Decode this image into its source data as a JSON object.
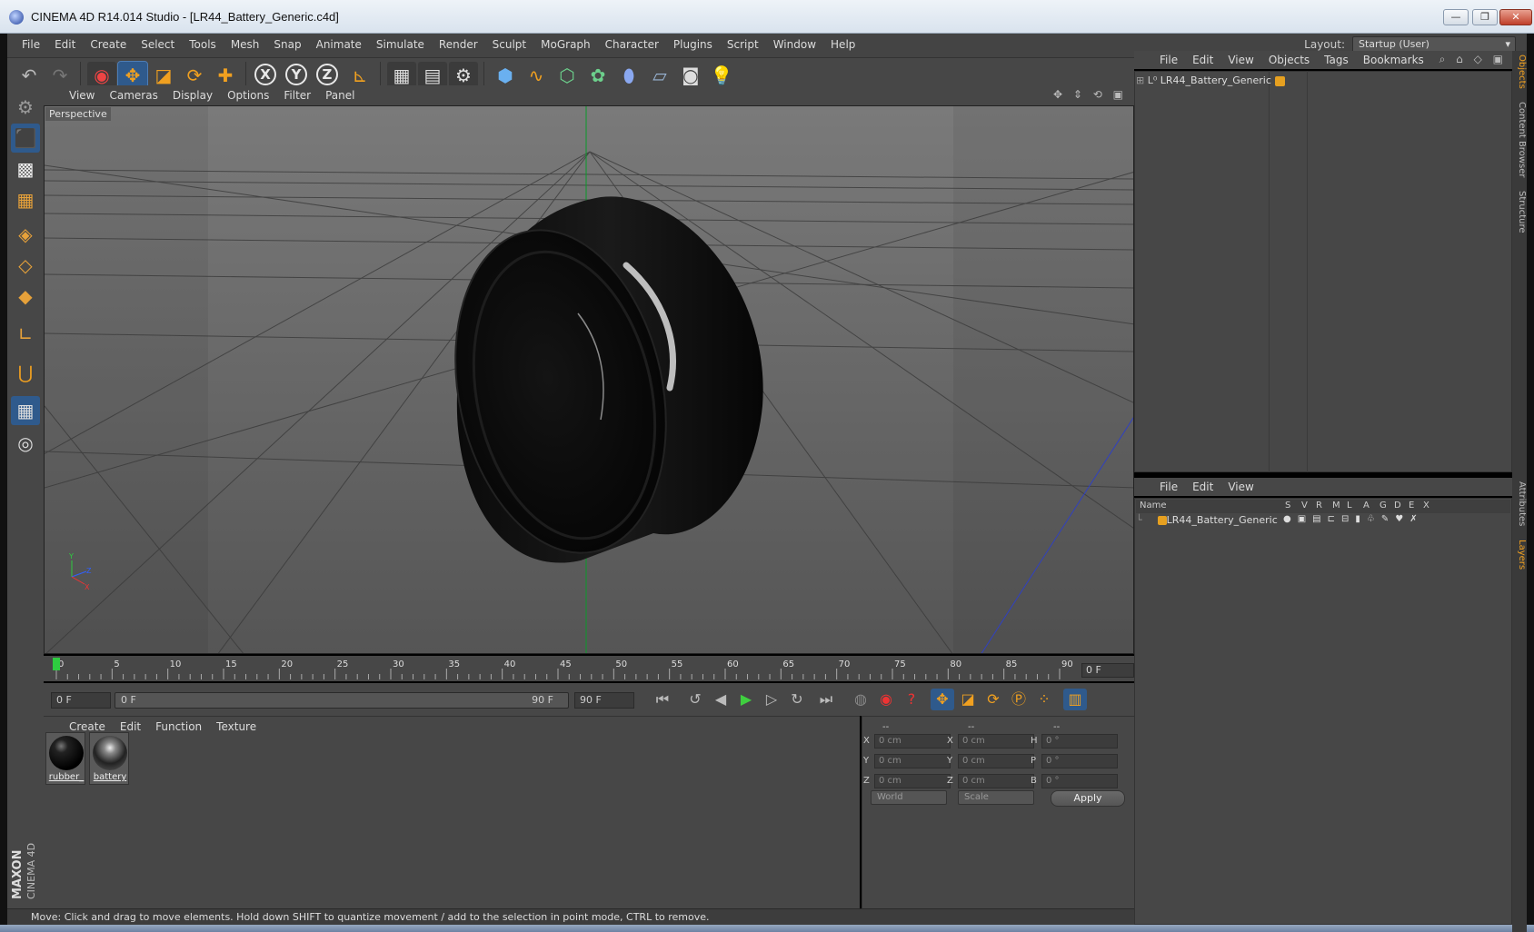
{
  "window": {
    "title": "CINEMA 4D R14.014 Studio - [LR44_Battery_Generic.c4d]",
    "minimize": "—",
    "restore": "❐",
    "close": "✕"
  },
  "menubar": {
    "items": [
      "File",
      "Edit",
      "Create",
      "Select",
      "Tools",
      "Mesh",
      "Snap",
      "Animate",
      "Simulate",
      "Render",
      "Sculpt",
      "MoGraph",
      "Character",
      "Plugins",
      "Script",
      "Window",
      "Help"
    ],
    "layout_label": "Layout:",
    "layout_value": "Startup (User)"
  },
  "viewport": {
    "menu": [
      "View",
      "Cameras",
      "Display",
      "Options",
      "Filter",
      "Panel"
    ],
    "label": "Perspective"
  },
  "timeline": {
    "ticks": [
      "0",
      "5",
      "10",
      "15",
      "20",
      "25",
      "30",
      "35",
      "40",
      "45",
      "50",
      "55",
      "60",
      "65",
      "70",
      "75",
      "80",
      "85",
      "90"
    ],
    "current_frame_box": "0 F",
    "start_field": "0 F",
    "range_start": "0 F",
    "range_end": "90 F",
    "end_field": "90 F"
  },
  "materials": {
    "menu": [
      "Create",
      "Edit",
      "Function",
      "Texture"
    ],
    "items": [
      {
        "name": "rubber_"
      },
      {
        "name": "battery"
      }
    ]
  },
  "coordinates": {
    "headers": [
      "--",
      "--",
      "--"
    ],
    "rows": [
      {
        "l1": "X",
        "v1": "0 cm",
        "l2": "X",
        "v2": "0 cm",
        "l3": "H",
        "v3": "0 °"
      },
      {
        "l1": "Y",
        "v1": "0 cm",
        "l2": "Y",
        "v2": "0 cm",
        "l3": "P",
        "v3": "0 °"
      },
      {
        "l1": "Z",
        "v1": "0 cm",
        "l2": "Z",
        "v2": "0 cm",
        "l3": "B",
        "v3": "0 °"
      }
    ],
    "mode_dropdown": "World",
    "scale_dropdown": "Scale",
    "apply_label": "Apply"
  },
  "object_manager": {
    "menu": [
      "File",
      "Edit",
      "View",
      "Objects",
      "Tags",
      "Bookmarks"
    ],
    "object_name": "LR44_Battery_Generic"
  },
  "layer_manager": {
    "menu": [
      "File",
      "Edit",
      "View"
    ],
    "columns": [
      "Name",
      "S",
      "V",
      "R",
      "M",
      "L",
      "A",
      "G",
      "D",
      "E",
      "X"
    ],
    "layer_name": "LR44_Battery_Generic"
  },
  "right_tabs": [
    "Objects",
    "Content Browser",
    "Structure",
    "Attributes",
    "Layers"
  ],
  "status": "Move: Click and drag to move elements. Hold down SHIFT to quantize movement / add to the selection in point mode, CTRL to remove.",
  "branding": {
    "line1": "MAXON",
    "line2": "CINEMA 4D"
  },
  "colors": {
    "accent": "#f0a020",
    "selected": "#2f5a8c",
    "panel": "#474747"
  }
}
